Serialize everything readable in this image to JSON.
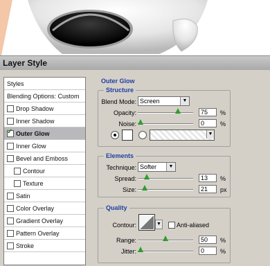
{
  "dialog": {
    "title": "Layer Style"
  },
  "styles_list": [
    {
      "label": "Styles",
      "checkbox": false,
      "checked": false,
      "selected": false,
      "indent": 0
    },
    {
      "label": "Blending Options: Custom",
      "checkbox": false,
      "checked": false,
      "selected": false,
      "indent": 0
    },
    {
      "label": "Drop Shadow",
      "checkbox": true,
      "checked": false,
      "selected": false,
      "indent": 0
    },
    {
      "label": "Inner Shadow",
      "checkbox": true,
      "checked": false,
      "selected": false,
      "indent": 0
    },
    {
      "label": "Outer Glow",
      "checkbox": true,
      "checked": true,
      "selected": true,
      "indent": 0
    },
    {
      "label": "Inner Glow",
      "checkbox": true,
      "checked": false,
      "selected": false,
      "indent": 0
    },
    {
      "label": "Bevel and Emboss",
      "checkbox": true,
      "checked": false,
      "selected": false,
      "indent": 0
    },
    {
      "label": "Contour",
      "checkbox": true,
      "checked": false,
      "selected": false,
      "indent": 1
    },
    {
      "label": "Texture",
      "checkbox": true,
      "checked": false,
      "selected": false,
      "indent": 1
    },
    {
      "label": "Satin",
      "checkbox": true,
      "checked": false,
      "selected": false,
      "indent": 0
    },
    {
      "label": "Color Overlay",
      "checkbox": true,
      "checked": false,
      "selected": false,
      "indent": 0
    },
    {
      "label": "Gradient Overlay",
      "checkbox": true,
      "checked": false,
      "selected": false,
      "indent": 0
    },
    {
      "label": "Pattern Overlay",
      "checkbox": true,
      "checked": false,
      "selected": false,
      "indent": 0
    },
    {
      "label": "Stroke",
      "checkbox": true,
      "checked": false,
      "selected": false,
      "indent": 0
    }
  ],
  "outer_glow": {
    "title": "Outer Glow",
    "structure": {
      "title": "Structure",
      "blend_mode_label": "Blend Mode:",
      "blend_mode_value": "Screen",
      "opacity_label": "Opacity:",
      "opacity_value": "75",
      "opacity_unit": "%",
      "opacity_level": 0.75,
      "noise_label": "Noise:",
      "noise_value": "0",
      "noise_unit": "%",
      "noise_level": 0.0
    },
    "elements": {
      "title": "Elements",
      "technique_label": "Technique:",
      "technique_value": "Softer",
      "spread_label": "Spread:",
      "spread_value": "13",
      "spread_unit": "%",
      "spread_level": 0.13,
      "size_label": "Size:",
      "size_value": "21",
      "size_unit": "px",
      "size_level": 0.085
    },
    "quality": {
      "title": "Quality",
      "contour_label": "Contour:",
      "anti_aliased_label": "Anti-aliased",
      "range_label": "Range:",
      "range_value": "50",
      "range_unit": "%",
      "range_level": 0.5,
      "jitter_label": "Jitter:",
      "jitter_value": "0",
      "jitter_unit": "%",
      "jitter_level": 0.0
    }
  },
  "colors": {
    "accent": "#1f3f9f",
    "slider_thumb": "#2d9d2d",
    "selected_row": "#b9b9bd"
  }
}
